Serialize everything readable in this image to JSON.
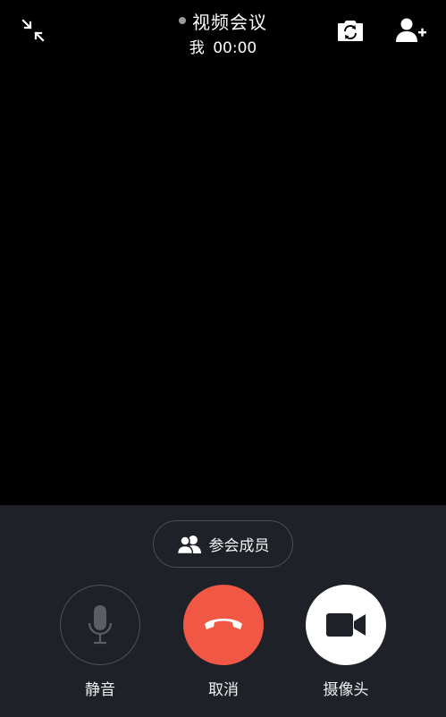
{
  "header": {
    "title": "视频会议",
    "participant": "我",
    "timer": "00:00",
    "status_dot_color": "#9a9a9a"
  },
  "members_button": {
    "label": "参会成员"
  },
  "controls": [
    {
      "label": "静音",
      "icon": "microphone-icon"
    },
    {
      "label": "取消",
      "icon": "hang-up-icon",
      "color": "#f05745"
    },
    {
      "label": "摄像头",
      "icon": "video-camera-icon"
    }
  ],
  "icons": {
    "minimize": "minimize-icon",
    "flip_camera": "flip-camera-icon",
    "add_member": "add-member-icon"
  }
}
